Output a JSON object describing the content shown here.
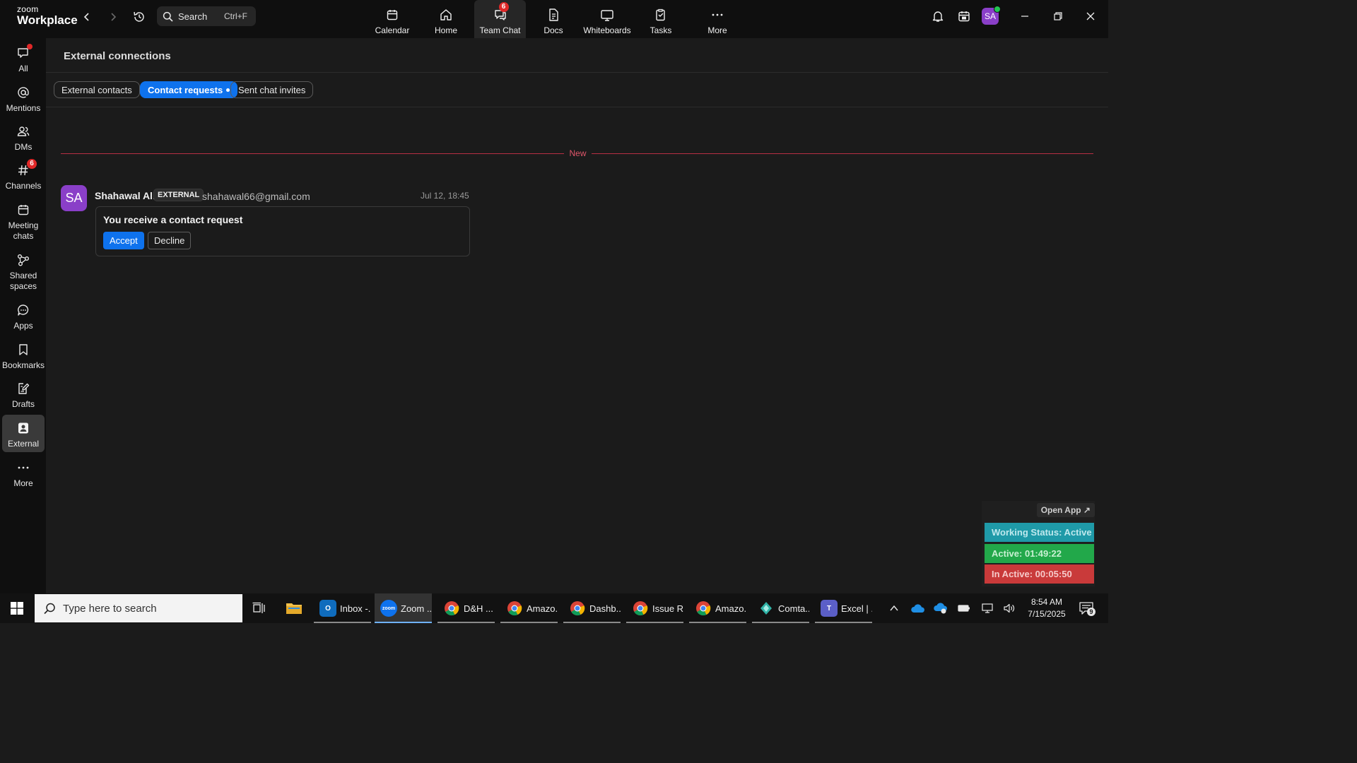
{
  "app": {
    "logo_top": "zoom",
    "logo_bottom": "Workplace"
  },
  "search": {
    "label": "Search",
    "shortcut": "Ctrl+F"
  },
  "app_tabs": [
    {
      "label": "Calendar",
      "icon": "calendar-icon"
    },
    {
      "label": "Home",
      "icon": "home-icon"
    },
    {
      "label": "Team Chat",
      "icon": "chat-icon",
      "badge": "6",
      "active": true
    },
    {
      "label": "Docs",
      "icon": "docs-icon"
    },
    {
      "label": "Whiteboards",
      "icon": "whiteboard-icon"
    },
    {
      "label": "Tasks",
      "icon": "tasks-icon"
    },
    {
      "label": "More",
      "icon": "more-icon"
    }
  ],
  "user": {
    "initials": "SA",
    "avatar_color": "#8a3fc8",
    "presence_color": "#23c552"
  },
  "sidebar": {
    "items": [
      {
        "label": "All",
        "icon": "chat-bubble-icon"
      },
      {
        "label": "Mentions",
        "icon": "at-icon"
      },
      {
        "label": "DMs",
        "icon": "people-icon"
      },
      {
        "label": "Channels",
        "icon": "hash-icon",
        "badge": "6"
      },
      {
        "label_1": "Meeting",
        "label_2": "chats",
        "icon": "calendar-icon"
      },
      {
        "label_1": "Shared",
        "label_2": "spaces",
        "icon": "share-icon"
      },
      {
        "label": "Apps",
        "icon": "apps-icon"
      },
      {
        "label": "Bookmarks",
        "icon": "bookmark-icon"
      },
      {
        "label": "Drafts",
        "icon": "drafts-icon"
      },
      {
        "label": "External",
        "icon": "contact-card-icon",
        "active": true
      },
      {
        "label": "More",
        "icon": "more-icon"
      }
    ]
  },
  "main": {
    "title": "External connections",
    "tabs": [
      {
        "label": "External contacts"
      },
      {
        "label": "Contact requests",
        "active": true
      },
      {
        "label": "Sent chat invites"
      }
    ],
    "divider_label": "New",
    "request": {
      "avatar": "SA",
      "sender": "Shahawal Ali",
      "badge": "EXTERNAL",
      "email": "shahawal66@gmail.com",
      "time": "Jul 12, 18:45",
      "title": "You receive a contact request",
      "accept": "Accept",
      "decline": "Decline"
    }
  },
  "widget": {
    "open_app": "Open App ↗",
    "working_status": "Working Status: Active",
    "active": "Active: 01:49:22",
    "inactive": "In Active: 00:05:50",
    "colors": {
      "working": "#1f9aa8",
      "active": "#22a84a",
      "inactive": "#c93a3a"
    }
  },
  "taskbar": {
    "search_placeholder": "Type here to search",
    "apps": [
      {
        "label": "Inbox -...",
        "icon": "outlook-icon",
        "color": "#0f6cbd",
        "glyph": "O"
      },
      {
        "label": "Zoom ...",
        "icon": "zoom-icon",
        "color": "#0e72ed",
        "glyph": "zoom",
        "active": true
      },
      {
        "label": "D&H ...",
        "icon": "chrome-icon",
        "color": "#db4437"
      },
      {
        "label": "Amazo...",
        "icon": "chrome-icon",
        "color": "#db4437"
      },
      {
        "label": "Dashb...",
        "icon": "chrome-icon",
        "color": "#db4437"
      },
      {
        "label": "Issue R...",
        "icon": "chrome-icon",
        "color": "#db4437"
      },
      {
        "label": "Amazo...",
        "icon": "chrome-icon",
        "color": "#db4437"
      },
      {
        "label": "Comta...",
        "icon": "comta-icon",
        "color": "#2fb3a7"
      },
      {
        "label": "Excel | ...",
        "icon": "teams-icon",
        "color": "#5b5fc7",
        "glyph": "T"
      }
    ],
    "time": "8:54 AM",
    "date": "7/15/2025",
    "notifications": "9"
  }
}
